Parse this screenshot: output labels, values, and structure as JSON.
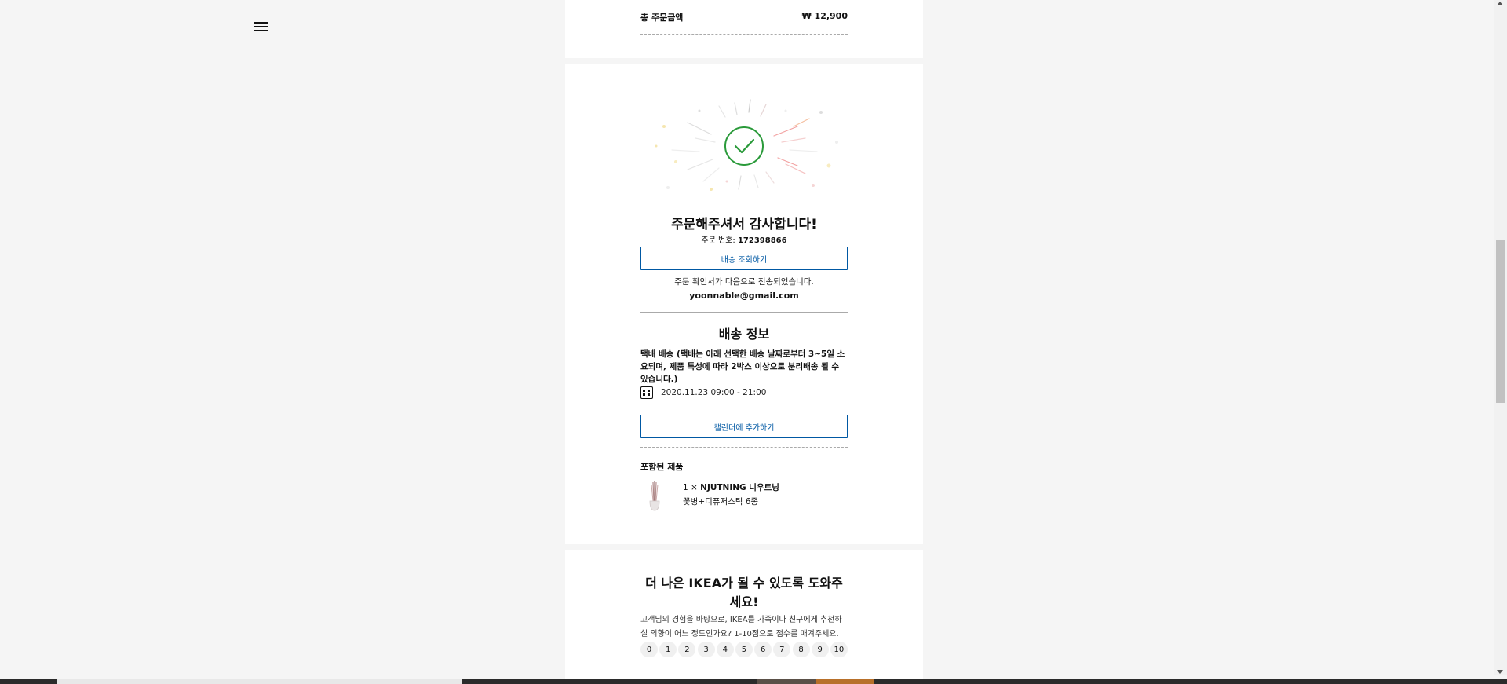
{
  "summary": {
    "total_label": "총 주문금액",
    "total_value": "₩ 12,900"
  },
  "confirmation": {
    "title": "주문해주셔서 감사합니다!",
    "order_label": "주문 번호: ",
    "order_number": "172398866",
    "track_button": "배송 조회하기",
    "email_sent_text": "주문 확인서가 다음으로 전송되었습니다.",
    "email": "yoonnable@gmail.com"
  },
  "delivery": {
    "title": "배송 정보",
    "description": "택배 배송 (택배는 아래 선택한 배송 날짜로부터 3~5일 소요되며, 제품 특성에 따라 2박스 이상으로 분리배송 될 수 있습니다.)",
    "date_range": "2020.11.23 09:00 - 21:00",
    "calendar_button": "캘린더에 추가하기"
  },
  "products": {
    "title": "포함된 제품",
    "items": [
      {
        "qty": "1 × ",
        "name": "NJUTNING 니우트닝",
        "desc": "꽃병+디퓨저스틱 6종"
      }
    ]
  },
  "survey": {
    "title": "더 나은 IKEA가 될 수 있도록 도와주세요!",
    "description": "고객님의 경험을 바탕으로, IKEA를 가족이나 친구에게 추천하실 의향이 어느 정도인가요? 1-10점으로 점수를 매겨주세요.",
    "ratings": [
      "0",
      "1",
      "2",
      "3",
      "4",
      "5",
      "6",
      "7",
      "8",
      "9",
      "10"
    ]
  },
  "colors": {
    "accent": "#0058a3",
    "success": "#2a9a3a",
    "background": "#f5f5f5"
  },
  "icons": {
    "menu": "hamburger-menu-icon",
    "check": "check-circle-icon",
    "calendar": "calendar-icon"
  }
}
